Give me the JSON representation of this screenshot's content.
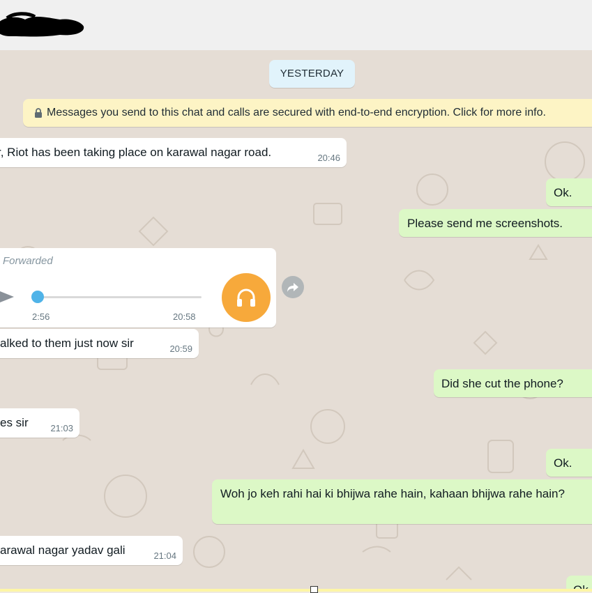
{
  "header": {
    "contact_name_redacted": "redacted contact name"
  },
  "chat": {
    "date_divider": "YESTERDAY",
    "encryption_notice": "Messages you send to this chat and calls are secured with end-to-end encryption. Click for more info.",
    "messages": [
      {
        "dir": "in",
        "text": "r, Riot has been taking place on karawal nagar road.",
        "time": "20:46"
      },
      {
        "dir": "out",
        "text": "Ok.",
        "time": ""
      },
      {
        "dir": "out",
        "text": "Please send me screenshots.",
        "time": ""
      },
      {
        "dir": "in",
        "type": "voice",
        "forwarded_label": "Forwarded",
        "duration": "2:56",
        "time": "20:58",
        "progress": 0.0
      },
      {
        "dir": "in",
        "text": "alked to them just now sir",
        "time": "20:59"
      },
      {
        "dir": "out",
        "text": "Did she cut the phone?",
        "time": ""
      },
      {
        "dir": "in",
        "text": "es sir",
        "time": "21:03"
      },
      {
        "dir": "out",
        "text": "Ok.",
        "time": ""
      },
      {
        "dir": "out",
        "text": "Woh jo keh rahi hai ki bhijwa rahe hain, kahaan bhijwa rahe hain?",
        "time": ""
      },
      {
        "dir": "in",
        "text": "arawal nagar yadav gali",
        "time": "21:04"
      },
      {
        "dir": "out",
        "text": "Ok.",
        "time": ""
      }
    ]
  },
  "icons": {
    "lock": "lock-icon",
    "play": "play-icon",
    "headphones": "headphones-icon",
    "forward": "forward-icon"
  },
  "colors": {
    "incoming_bubble": "#ffffff",
    "outgoing_bubble": "#dcf8c6",
    "chat_background": "#e5ddd5",
    "date_chip": "#e1f3fb",
    "encryption_notice": "#fdf4c5",
    "voice_avatar": "#f7a93b",
    "voice_progress": "#4fb3e8"
  }
}
